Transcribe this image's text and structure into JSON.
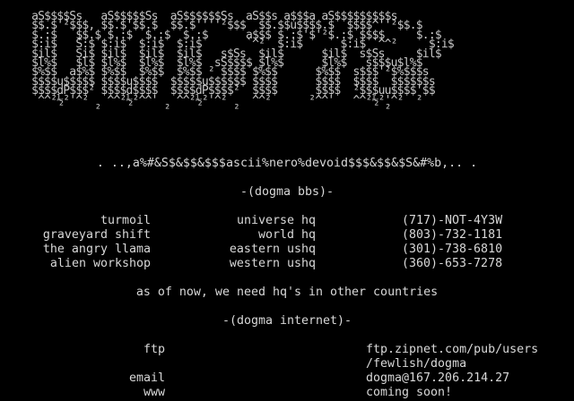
{
  "logo_text": "     aS$$$$Ss   aS$$$$$Ss  aS$$$$$$Ss  aS$$s a$$$a aS$$$$$$$$$s\n     $$.$'²$$$, $$.$'$$.$  $$.$''''²$$$  $$.$$u$$$$.$  $$$$^''²$$.$\n     $.:$   $$.$ $.:$  $.:$  $.:$      a$$$ $.:$'$'²$.:$ $$$$     $.:$\n     $:i$   S:$ $:i$  $:i$  $:i$       `^²  $:i$      $:i$ `^^²     $:i$\n     $il$   Si$ $il$  $il$  $il$   s$Ss  $il$      $il$  s$Ss     $il$\n     $l%$   $l$ $l%$  $l%$  $l%$  sS$$$$ $l%$      $l%$   s$$$u$l%$\n     $%$$  a$%$ $%$$  $%$$  $%$$ ² $$$$ $%$$      $%$$  s$$$'²$%$$$s\n     $$$$u$$$$$ $$$$u$$$$  $$$$$u$$$$$$ $$$$      $$$$  $$$$  $$$$$$s\n     $$$$dP$$$² $$$$d$$$$  $$$$dP$$$$²  $$$$      $$$$  ²$$$uu$$$$'$$\n      ^^²½²'^²   ^^²½²^^'   ^^²½²'^²    ^^²      ²^^'   ^^²½²'^²  ²\n               ²          ²          ²                       ²",
  "tagline": ". ..,a%#&S$&$$&$$$ascii%nero%devoid$$$&$$&$S&#%b,.. .",
  "bbs_header": "-(dogma bbs)-",
  "bbs_entries": [
    {
      "name": "turmoil",
      "role": "universe hq",
      "phone": "(717)-NOT-4Y3W"
    },
    {
      "name": "graveyard shift",
      "role": "world hq",
      "phone": "(803)-732-1181"
    },
    {
      "name": "the angry llama",
      "role": "eastern ushq",
      "phone": "(301)-738-6810"
    },
    {
      "name": "alien workshop",
      "role": "western ushq",
      "phone": "(360)-653-7278"
    }
  ],
  "notice": "as of now, we need hq's in other countries",
  "internet_header": "-(dogma internet)-",
  "internet_entries": [
    {
      "label": "ftp",
      "value": "ftp.zipnet.com/pub/users"
    },
    {
      "label": "",
      "value": "/fewlish/dogma"
    },
    {
      "label": "email",
      "value": "dogma@167.206.214.27"
    },
    {
      "label": "www",
      "value": "coming soon!"
    }
  ]
}
